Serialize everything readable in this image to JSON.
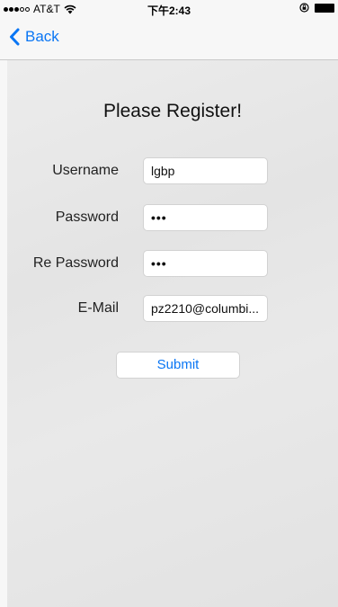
{
  "status_bar": {
    "carrier": "AT&T",
    "time": "下午2:43",
    "signal_icon": "signal-dots-icon",
    "wifi_icon": "wifi-icon",
    "rotation_icon": "rotation-lock-icon",
    "battery_icon": "battery-icon"
  },
  "nav": {
    "back_label": "Back",
    "back_icon": "chevron-left-icon",
    "accent_color": "#0a76f4"
  },
  "form": {
    "title": "Please Register!",
    "fields": [
      {
        "label": "Username",
        "value": "lgbp"
      },
      {
        "label": "Password",
        "value": "•••"
      },
      {
        "label": "Re Password",
        "value": "•••"
      },
      {
        "label": "E-Mail",
        "value": "pz2210@columbi..."
      }
    ],
    "submit_label": "Submit"
  }
}
